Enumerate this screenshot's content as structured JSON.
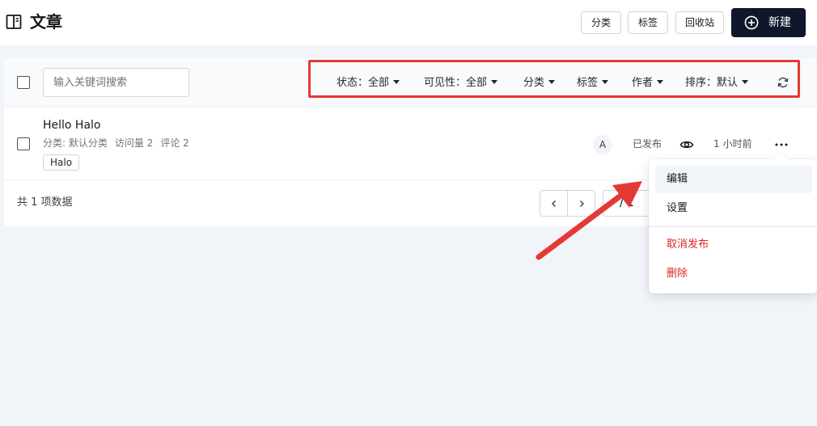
{
  "header": {
    "title": "文章",
    "buttons": {
      "category": "分类",
      "tag": "标签",
      "recycle": "回收站",
      "new": "新建"
    }
  },
  "toolbar": {
    "search_placeholder": "输入关键词搜索",
    "filters": {
      "status": "状态：全部",
      "visibility": "可见性：全部",
      "category": "分类",
      "tag": "标签",
      "author": "作者",
      "sort": "排序：默认"
    }
  },
  "post": {
    "title": "Hello Halo",
    "meta": {
      "category": "分类:  默认分类",
      "views": "访问量 2",
      "comments": "评论 2"
    },
    "tag": "Halo",
    "author_initial": "A",
    "status": "已发布",
    "time": "1 小时前"
  },
  "footer": {
    "total": "共 1 项数据",
    "page": "/ 1"
  },
  "menu": {
    "edit": "编辑",
    "settings": "设置",
    "unpublish": "取消发布",
    "delete": "删除"
  },
  "colors": {
    "primary": "#0f172a",
    "danger": "#dc2626",
    "highlight": "#e53935",
    "background": "#f1f5f9"
  }
}
